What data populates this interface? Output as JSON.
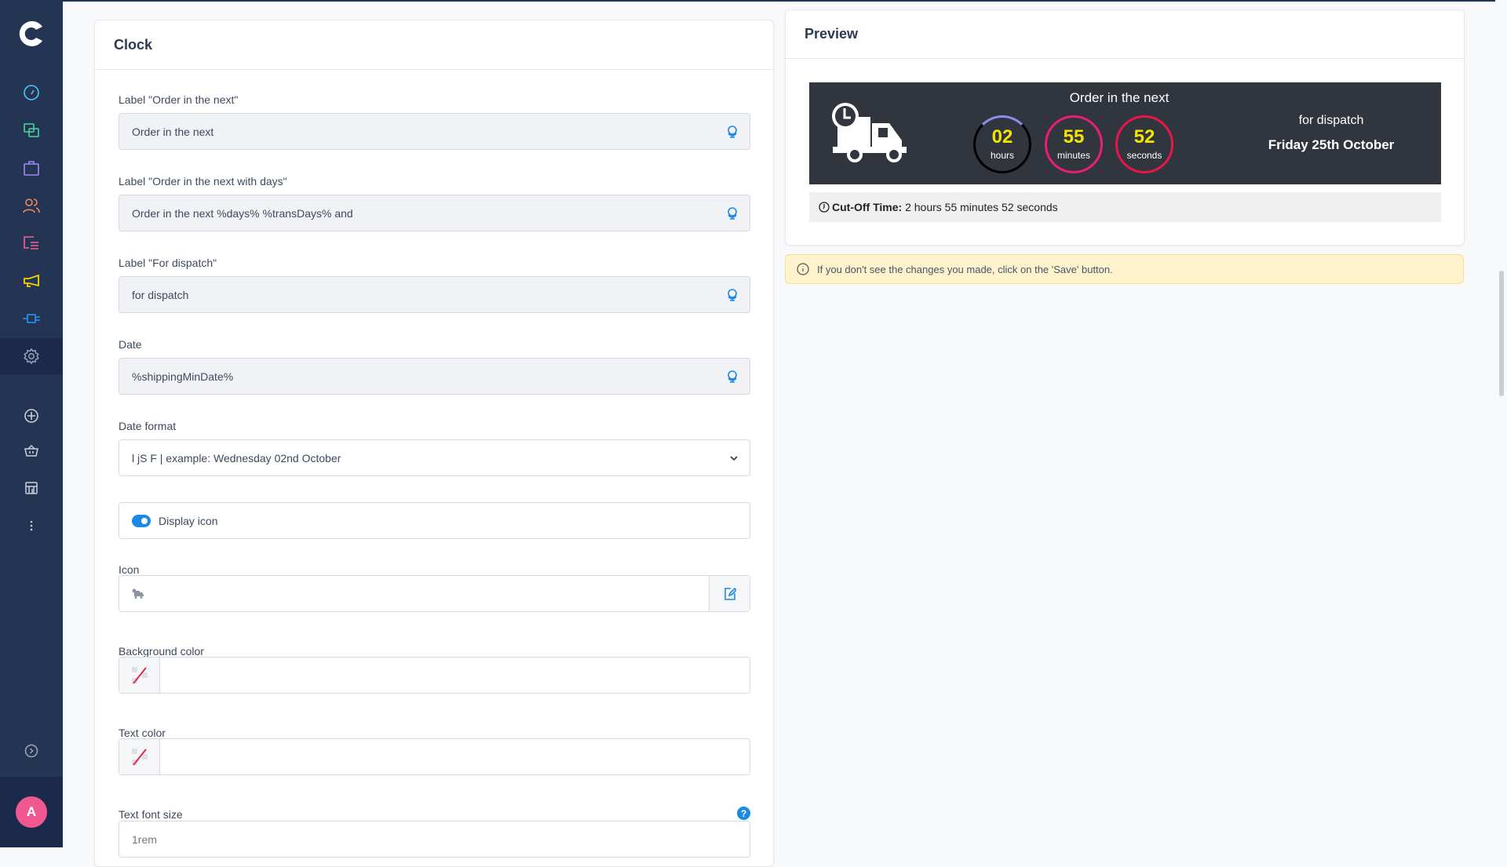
{
  "sidebar": {
    "items": [
      {
        "icon": "dashboard-icon",
        "color": "#4fc3f7"
      },
      {
        "icon": "catalog-icon",
        "color": "#4cd4a0"
      },
      {
        "icon": "orders-icon",
        "color": "#9f8cf0"
      },
      {
        "icon": "customers-icon",
        "color": "#f08a5d"
      },
      {
        "icon": "content-icon",
        "color": "#f06292"
      },
      {
        "icon": "marketing-icon",
        "color": "#f5d000"
      },
      {
        "icon": "extensions-icon",
        "color": "#2196f3"
      },
      {
        "icon": "settings-icon",
        "color": "#9aa6b8",
        "active": true
      },
      {
        "icon": "add-icon",
        "color": "#c8d0dc"
      },
      {
        "icon": "basket-icon",
        "color": "#c8d0dc"
      },
      {
        "icon": "store-icon",
        "color": "#c8d0dc"
      },
      {
        "icon": "more-icon",
        "color": "#c8d0dc"
      }
    ],
    "avatar": "A"
  },
  "clock": {
    "title": "Clock",
    "fields": [
      {
        "label": "Label \"Order in the next\"",
        "value": "Order in the next"
      },
      {
        "label": "Label \"Order in the next with days\"",
        "value": "Order in the next %days% %transDays% and"
      },
      {
        "label": "Label \"For dispatch\"",
        "value": "for dispatch"
      },
      {
        "label": "Date",
        "value": "%shippingMinDate%"
      }
    ],
    "date_format": {
      "label": "Date format",
      "value": "l jS F | example: Wednesday 02nd October"
    },
    "display_icon": {
      "label": "Display icon",
      "checked": true
    },
    "icon": {
      "label": "Icon"
    },
    "bg_color": {
      "label": "Background color",
      "value": ""
    },
    "text_color": {
      "label": "Text color",
      "value": ""
    },
    "font_size": {
      "label": "Text font size",
      "placeholder": "1rem"
    }
  },
  "preview": {
    "title": "Preview",
    "heading": "Order in the next",
    "hours": "02",
    "hours_label": "hours",
    "minutes": "55",
    "minutes_label": "minutes",
    "seconds": "52",
    "seconds_label": "seconds",
    "dispatch": "for dispatch",
    "date": "Friday 25th October",
    "cutoff_label": "Cut-Off Time:",
    "cutoff_value": "2 hours 55 minutes 52 seconds",
    "colors": {
      "box": "#30353e",
      "digits": "#f5e400",
      "hours_ring": "#000000",
      "minutes_ring": "#e91e7a",
      "seconds_ring": "#e8164a"
    }
  },
  "alert": "If you don't see the changes you made, click on the 'Save' button."
}
